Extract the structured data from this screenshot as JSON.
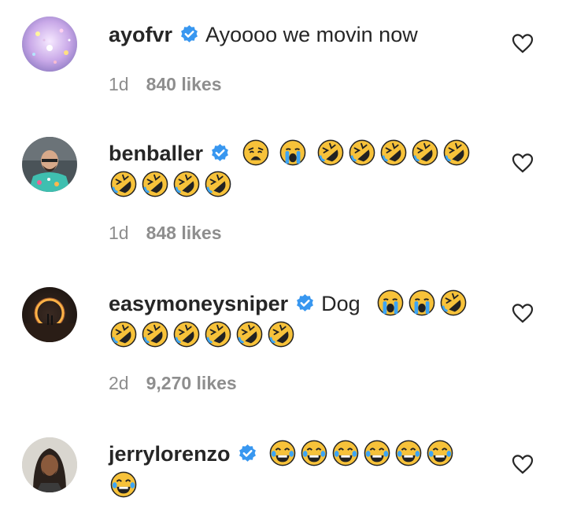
{
  "comments": [
    {
      "username": "ayofvr",
      "text": "Ayoooo we movin now",
      "emojis": [],
      "time": "1d",
      "likes": "840 likes",
      "avatar": "sparkle-avatar"
    },
    {
      "username": "benballer",
      "text": "",
      "emojis": [
        "weary-face",
        "loudly-crying-face",
        "rofl-face",
        "rofl-face",
        "rofl-face",
        "rofl-face",
        "rofl-face",
        "rofl-face",
        "rofl-face",
        "rofl-face",
        "rofl-face"
      ],
      "time": "1d",
      "likes": "848 likes",
      "avatar": "man-photo-avatar"
    },
    {
      "username": "easymoneysniper",
      "text": "Dog",
      "emojis": [
        "loudly-crying-face",
        "loudly-crying-face",
        "rofl-face",
        "rofl-face",
        "rofl-face",
        "rofl-face",
        "rofl-face",
        "rofl-face",
        "rofl-face"
      ],
      "time": "2d",
      "likes": "9,270 likes",
      "avatar": "sunset-ring-avatar"
    },
    {
      "username": "jerrylorenzo",
      "text": "",
      "emojis": [
        "tears-of-joy-face",
        "tears-of-joy-face",
        "tears-of-joy-face",
        "tears-of-joy-face",
        "tears-of-joy-face",
        "tears-of-joy-face",
        "tears-of-joy-face"
      ],
      "time": "",
      "likes": "",
      "avatar": "portrait-avatar"
    }
  ],
  "colors": {
    "text": "#262626",
    "meta": "#8e8e8e",
    "verified": "#3897f0",
    "emoji": "#f7c23a"
  }
}
